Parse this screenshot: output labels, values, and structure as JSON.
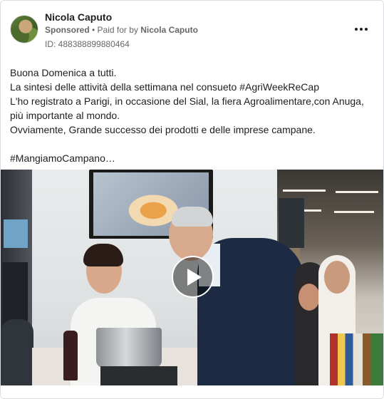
{
  "post": {
    "page_name": "Nicola Caputo",
    "sponsored_label": "Sponsored",
    "separator": " • ",
    "paid_for_prefix": "Paid for by ",
    "paid_for_name": "Nicola Caputo",
    "id_line": "ID: 488388899880464",
    "text_lines": [
      "Buona Domenica a tutti.",
      "La sintesi delle attività della settimana nel consueto #AgriWeekReCap",
      "L'ho registrato a Parigi, in occasione del Sial, la fiera Agroalimentare,con Anuga, più importante al mondo.",
      "Ovviamente, Grande successo dei prodotti e delle imprese campane."
    ],
    "hashtag_line": "#MangiamoCampano…"
  },
  "icons": {
    "more": "more-options-icon",
    "play": "play-icon",
    "avatar": "profile-picture"
  },
  "colors": {
    "text_primary": "#1c1e21",
    "text_secondary": "#65676b",
    "border": "#dadde1"
  }
}
